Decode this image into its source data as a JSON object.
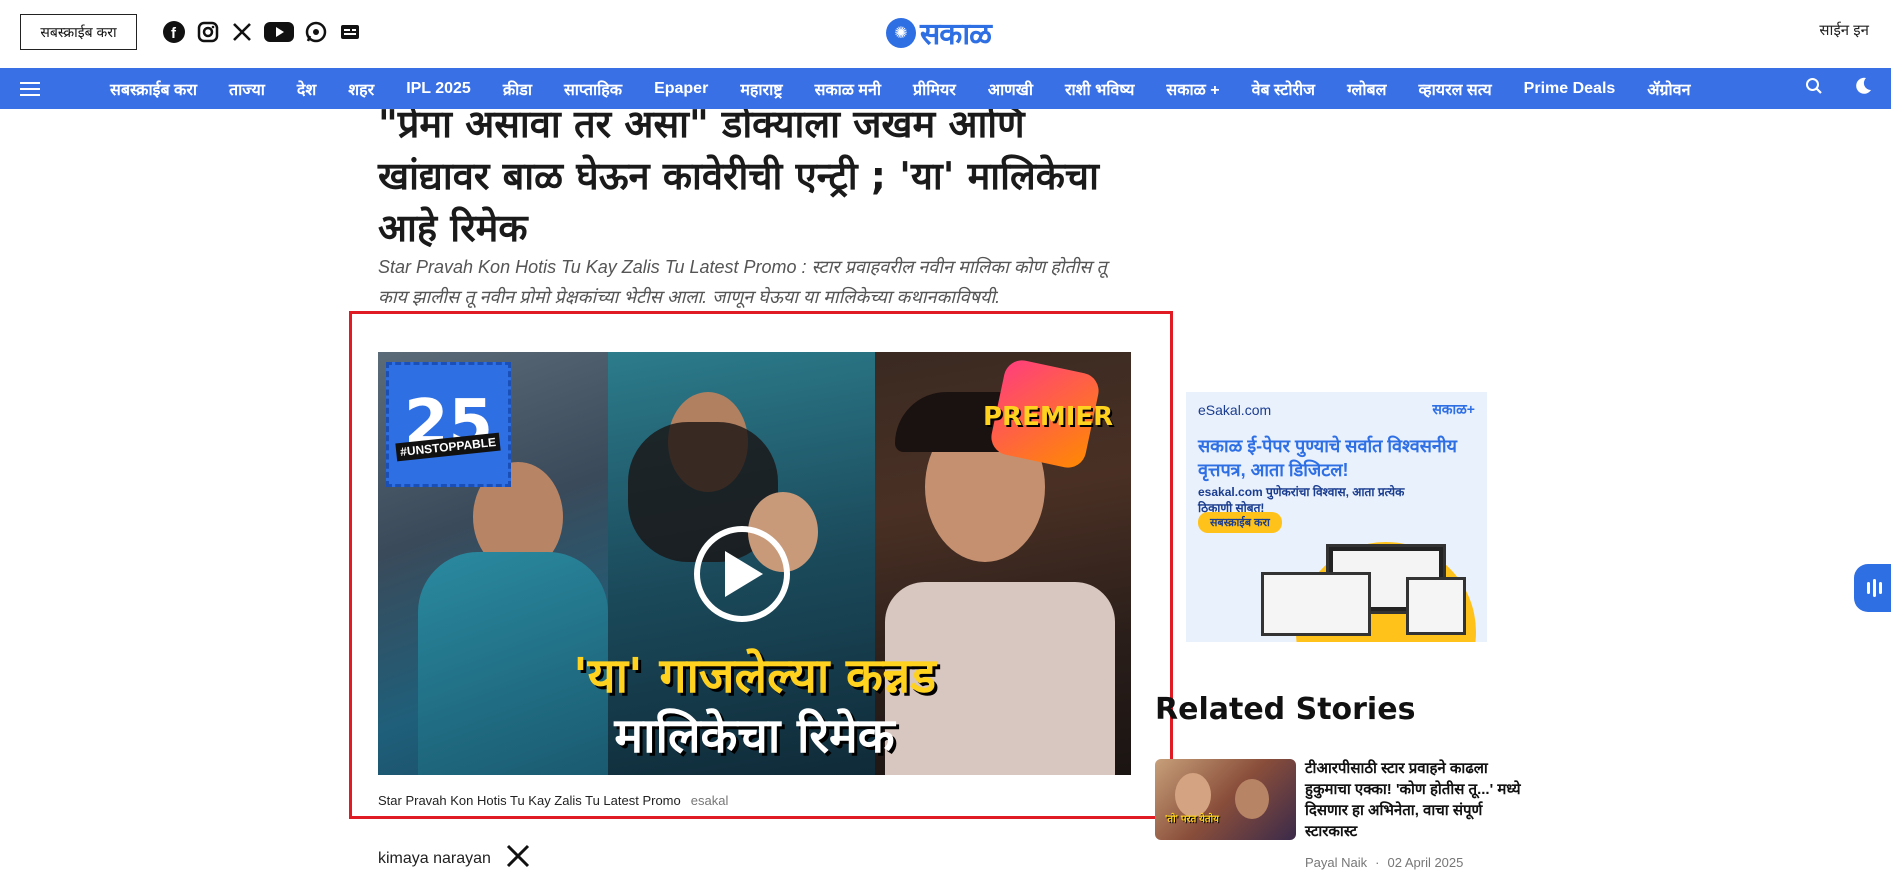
{
  "header": {
    "subscribe_label": "सबस्क्राईब करा",
    "logo_text": "सकाळ",
    "signin_label": "साईन इन",
    "socials": [
      "facebook-icon",
      "instagram-icon",
      "x-icon",
      "youtube-icon",
      "whatsapp-icon",
      "google-news-icon"
    ]
  },
  "nav": {
    "items": [
      "सबस्क्राईब करा",
      "ताज्या",
      "देश",
      "शहर",
      "IPL 2025",
      "क्रीडा",
      "साप्ताहिक",
      "Epaper",
      "महाराष्ट्र",
      "सकाळ मनी",
      "प्रीमियर",
      "आणखी",
      "राशी भविष्य",
      "सकाळ +",
      "वेब स्टोरीज",
      "ग्लोबल",
      "व्हायरल सत्य",
      "Prime Deals",
      "ॲग्रोवन"
    ],
    "icons": [
      "search-icon",
      "dark-mode-icon"
    ]
  },
  "article": {
    "headline": "\"प्रेमा असावा तर असा\" डोक्याला जखम आणि खांद्यावर बाळ घेऊन कावेरीची एन्ट्री ; 'या' मालिकेचा आहे रिमेक",
    "subtitle": "Star Pravah Kon Hotis Tu Kay Zalis Tu Latest Promo : स्टार प्रवाहवरील नवीन मालिका कोण होतीस तू काय झालीस तू नवीन प्रोमो प्रेक्षकांच्या भेटीस आला. जाणून घेऊया या मालिकेच्या कथानकाविषयी.",
    "video": {
      "badge_number": "25",
      "badge_tag": "#UNSTOPPABLE",
      "premier_label": "PREMIER",
      "overlay_line1": "'या' गाजलेल्या कन्नड",
      "overlay_line2": "मालिकेचा रिमेक"
    },
    "caption": "Star Pravah Kon Hotis Tu Kay Zalis Tu Latest Promo",
    "caption_source": "esakal",
    "author": "kimaya narayan"
  },
  "ad": {
    "site": "eSakal.com",
    "logo": "सकाळ+",
    "headline": "सकाळ ई-पेपर पुण्याचे सर्वात विश्वसनीय वृत्तपत्र, आता डिजिटल!",
    "small": "esakal.com पुणेकरांचा विश्वास, आता प्रत्येक ठिकाणी सोबत!",
    "button": "सबस्क्राईब करा"
  },
  "related": {
    "title": "Related Stories",
    "items": [
      {
        "headline": "टीआरपीसाठी स्टार प्रवाहने काढला हुकुमाचा एक्का! 'कोण होतीस तू...' मध्ये दिसणार हा अभिनेता, वाचा संपूर्ण स्टारकास्ट",
        "thumb_text": "'तो' परत येतोय",
        "author": "Payal Naik",
        "date": "02 April 2025"
      }
    ]
  },
  "colors": {
    "brand_blue": "#3a70e6",
    "highlight_red": "#e01b24"
  }
}
